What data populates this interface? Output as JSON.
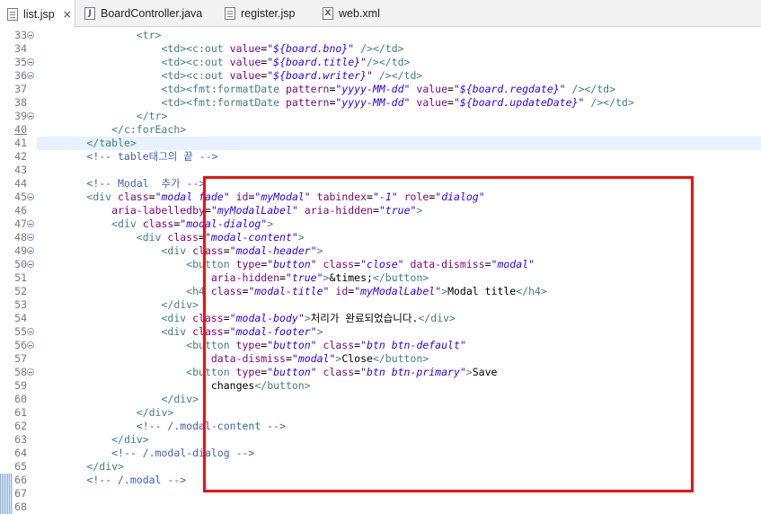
{
  "tabs": [
    {
      "label": "list.jsp",
      "icon": "jsp-file-icon",
      "active": true,
      "close": "×"
    },
    {
      "label": "BoardController.java",
      "icon": "java-file-icon",
      "glyph": "J"
    },
    {
      "label": "register.jsp",
      "icon": "jsp-file-icon"
    },
    {
      "label": "web.xml",
      "icon": "xml-file-icon",
      "glyph": "X"
    }
  ],
  "editor": {
    "current_line": 41,
    "lines": [
      {
        "n": 33,
        "fold": true,
        "segs": [
          [
            "x",
            "                "
          ],
          [
            "t",
            "<tr>"
          ]
        ]
      },
      {
        "n": 34,
        "segs": [
          [
            "x",
            "                    "
          ],
          [
            "t",
            "<td><c:out "
          ],
          [
            "a",
            "value"
          ],
          [
            "x",
            "="
          ],
          [
            "v",
            "\"${board.bno}\""
          ],
          [
            "x",
            " "
          ],
          [
            "t",
            "/></td>"
          ]
        ]
      },
      {
        "n": 35,
        "fold": true,
        "segs": [
          [
            "x",
            "                    "
          ],
          [
            "t",
            "<td><c:out "
          ],
          [
            "a",
            "value"
          ],
          [
            "x",
            "="
          ],
          [
            "v",
            "\"${board.title}\""
          ],
          [
            "t",
            "/></td>"
          ]
        ]
      },
      {
        "n": 36,
        "fold": true,
        "segs": [
          [
            "x",
            "                    "
          ],
          [
            "t",
            "<td><c:out "
          ],
          [
            "a",
            "value"
          ],
          [
            "x",
            "="
          ],
          [
            "v",
            "\"${board.writer}\""
          ],
          [
            "x",
            " "
          ],
          [
            "t",
            "/></td>"
          ]
        ]
      },
      {
        "n": 37,
        "segs": [
          [
            "x",
            "                    "
          ],
          [
            "t",
            "<td><fmt:formatDate "
          ],
          [
            "a",
            "pattern"
          ],
          [
            "x",
            "="
          ],
          [
            "v",
            "\"yyyy-MM-dd\""
          ],
          [
            "x",
            " "
          ],
          [
            "a",
            "value"
          ],
          [
            "x",
            "="
          ],
          [
            "v",
            "\"${board.regdate}\""
          ],
          [
            "x",
            " "
          ],
          [
            "t",
            "/></td>"
          ]
        ]
      },
      {
        "n": 38,
        "segs": [
          [
            "x",
            "                    "
          ],
          [
            "t",
            "<td><fmt:formatDate "
          ],
          [
            "a",
            "pattern"
          ],
          [
            "x",
            "="
          ],
          [
            "v",
            "\"yyyy-MM-dd\""
          ],
          [
            "x",
            " "
          ],
          [
            "a",
            "value"
          ],
          [
            "x",
            "="
          ],
          [
            "v",
            "\"${board.updateDate}\""
          ],
          [
            "x",
            " "
          ],
          [
            "t",
            "/></td>"
          ]
        ]
      },
      {
        "n": 39,
        "fold": true,
        "segs": [
          [
            "x",
            "                "
          ],
          [
            "t",
            "</tr>"
          ]
        ]
      },
      {
        "n": 40,
        "under": true,
        "segs": [
          [
            "x",
            "            "
          ],
          [
            "t",
            "</c:forEach>"
          ]
        ]
      },
      {
        "n": 41,
        "segs": [
          [
            "x",
            "        "
          ],
          [
            "t",
            "</table>"
          ]
        ]
      },
      {
        "n": 42,
        "segs": [
          [
            "x",
            "        "
          ],
          [
            "c",
            "<!-- table태그의 끝 -->"
          ]
        ]
      },
      {
        "n": 43,
        "segs": []
      },
      {
        "n": 44,
        "segs": [
          [
            "x",
            "        "
          ],
          [
            "c",
            "<!-- Modal  추가 -->"
          ]
        ]
      },
      {
        "n": 45,
        "fold": true,
        "segs": [
          [
            "x",
            "        "
          ],
          [
            "t",
            "<div "
          ],
          [
            "a",
            "class"
          ],
          [
            "x",
            "="
          ],
          [
            "v",
            "\"modal fade\""
          ],
          [
            "x",
            " "
          ],
          [
            "a",
            "id"
          ],
          [
            "x",
            "="
          ],
          [
            "v",
            "\"myModal\""
          ],
          [
            "x",
            " "
          ],
          [
            "a",
            "tabindex"
          ],
          [
            "x",
            "="
          ],
          [
            "v",
            "\"-1\""
          ],
          [
            "x",
            " "
          ],
          [
            "a",
            "role"
          ],
          [
            "x",
            "="
          ],
          [
            "v",
            "\"dialog\""
          ]
        ]
      },
      {
        "n": 46,
        "segs": [
          [
            "x",
            "            "
          ],
          [
            "a",
            "aria-labelledby"
          ],
          [
            "x",
            "="
          ],
          [
            "v",
            "\"myModalLabel\""
          ],
          [
            "x",
            " "
          ],
          [
            "a",
            "aria-hidden"
          ],
          [
            "x",
            "="
          ],
          [
            "v",
            "\"true\""
          ],
          [
            "t",
            ">"
          ]
        ]
      },
      {
        "n": 47,
        "fold": true,
        "segs": [
          [
            "x",
            "            "
          ],
          [
            "t",
            "<div "
          ],
          [
            "a",
            "class"
          ],
          [
            "x",
            "="
          ],
          [
            "v",
            "\"modal-dialog\""
          ],
          [
            "t",
            ">"
          ]
        ]
      },
      {
        "n": 48,
        "fold": true,
        "segs": [
          [
            "x",
            "                "
          ],
          [
            "t",
            "<div "
          ],
          [
            "a",
            "class"
          ],
          [
            "x",
            "="
          ],
          [
            "v",
            "\"modal-content\""
          ],
          [
            "t",
            ">"
          ]
        ]
      },
      {
        "n": 49,
        "fold": true,
        "segs": [
          [
            "x",
            "                    "
          ],
          [
            "t",
            "<div "
          ],
          [
            "a",
            "class"
          ],
          [
            "x",
            "="
          ],
          [
            "v",
            "\"modal-header\""
          ],
          [
            "t",
            ">"
          ]
        ]
      },
      {
        "n": 50,
        "fold": true,
        "segs": [
          [
            "x",
            "                        "
          ],
          [
            "t",
            "<button "
          ],
          [
            "a",
            "type"
          ],
          [
            "x",
            "="
          ],
          [
            "v",
            "\"button\""
          ],
          [
            "x",
            " "
          ],
          [
            "a",
            "class"
          ],
          [
            "x",
            "="
          ],
          [
            "v",
            "\"close\""
          ],
          [
            "x",
            " "
          ],
          [
            "a",
            "data-dismiss"
          ],
          [
            "x",
            "="
          ],
          [
            "v",
            "\"modal\""
          ]
        ]
      },
      {
        "n": 51,
        "segs": [
          [
            "x",
            "                            "
          ],
          [
            "a",
            "aria-hidden"
          ],
          [
            "x",
            "="
          ],
          [
            "v",
            "\"true\""
          ],
          [
            "t",
            ">"
          ],
          [
            "x",
            "&times;"
          ],
          [
            "t",
            "</button>"
          ]
        ]
      },
      {
        "n": 52,
        "segs": [
          [
            "x",
            "                        "
          ],
          [
            "t",
            "<h4 "
          ],
          [
            "a",
            "class"
          ],
          [
            "x",
            "="
          ],
          [
            "v",
            "\"modal-title\""
          ],
          [
            "x",
            " "
          ],
          [
            "a",
            "id"
          ],
          [
            "x",
            "="
          ],
          [
            "v",
            "\"myModalLabel\""
          ],
          [
            "t",
            ">"
          ],
          [
            "x",
            "Modal title"
          ],
          [
            "t",
            "</h4>"
          ]
        ]
      },
      {
        "n": 53,
        "segs": [
          [
            "x",
            "                    "
          ],
          [
            "t",
            "</div>"
          ]
        ]
      },
      {
        "n": 54,
        "segs": [
          [
            "x",
            "                    "
          ],
          [
            "t",
            "<div "
          ],
          [
            "a",
            "class"
          ],
          [
            "x",
            "="
          ],
          [
            "v",
            "\"modal-body\""
          ],
          [
            "t",
            ">"
          ],
          [
            "x",
            "처리가 완료되었습니다."
          ],
          [
            "t",
            "</div>"
          ]
        ]
      },
      {
        "n": 55,
        "fold": true,
        "segs": [
          [
            "x",
            "                    "
          ],
          [
            "t",
            "<div "
          ],
          [
            "a",
            "class"
          ],
          [
            "x",
            "="
          ],
          [
            "v",
            "\"modal-footer\""
          ],
          [
            "t",
            ">"
          ]
        ]
      },
      {
        "n": 56,
        "fold": true,
        "segs": [
          [
            "x",
            "                        "
          ],
          [
            "t",
            "<button "
          ],
          [
            "a",
            "type"
          ],
          [
            "x",
            "="
          ],
          [
            "v",
            "\"button\""
          ],
          [
            "x",
            " "
          ],
          [
            "a",
            "class"
          ],
          [
            "x",
            "="
          ],
          [
            "v",
            "\"btn btn-default\""
          ]
        ]
      },
      {
        "n": 57,
        "segs": [
          [
            "x",
            "                            "
          ],
          [
            "a",
            "data-dismiss"
          ],
          [
            "x",
            "="
          ],
          [
            "v",
            "\"modal\""
          ],
          [
            "t",
            ">"
          ],
          [
            "x",
            "Close"
          ],
          [
            "t",
            "</button>"
          ]
        ]
      },
      {
        "n": 58,
        "fold": true,
        "segs": [
          [
            "x",
            "                        "
          ],
          [
            "t",
            "<button "
          ],
          [
            "a",
            "type"
          ],
          [
            "x",
            "="
          ],
          [
            "v",
            "\"button\""
          ],
          [
            "x",
            " "
          ],
          [
            "a",
            "class"
          ],
          [
            "x",
            "="
          ],
          [
            "v",
            "\"btn btn-primary\""
          ],
          [
            "t",
            ">"
          ],
          [
            "x",
            "Save"
          ]
        ]
      },
      {
        "n": 59,
        "segs": [
          [
            "x",
            "                            "
          ],
          [
            "x",
            "changes"
          ],
          [
            "t",
            "</button>"
          ]
        ]
      },
      {
        "n": 60,
        "segs": [
          [
            "x",
            "                    "
          ],
          [
            "t",
            "</div>"
          ]
        ]
      },
      {
        "n": 61,
        "segs": [
          [
            "x",
            "                "
          ],
          [
            "t",
            "</div>"
          ]
        ]
      },
      {
        "n": 62,
        "segs": [
          [
            "x",
            "                "
          ],
          [
            "c",
            "<!-- /.modal-content -->"
          ]
        ]
      },
      {
        "n": 63,
        "segs": [
          [
            "x",
            "            "
          ],
          [
            "t",
            "</div>"
          ]
        ]
      },
      {
        "n": 64,
        "segs": [
          [
            "x",
            "            "
          ],
          [
            "c",
            "<!-- /.modal-dialog -->"
          ]
        ]
      },
      {
        "n": 65,
        "segs": [
          [
            "x",
            "        "
          ],
          [
            "t",
            "</div>"
          ]
        ]
      },
      {
        "n": 66,
        "diff": true,
        "segs": [
          [
            "x",
            "        "
          ],
          [
            "c",
            "<!-- /.modal -->"
          ]
        ]
      },
      {
        "n": 67,
        "diff": true,
        "segs": []
      },
      {
        "n": 68,
        "diff": true,
        "segs": []
      }
    ]
  },
  "highlight": {
    "color": "#ee1111",
    "from_line": 44,
    "to_line": 66
  }
}
